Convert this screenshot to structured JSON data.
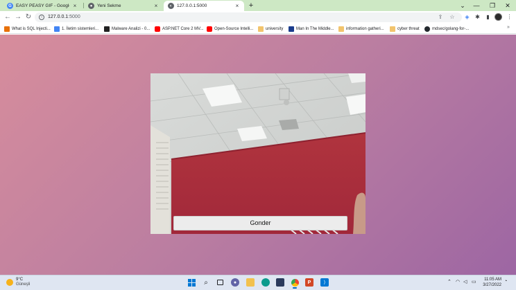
{
  "browser": {
    "tabs": [
      {
        "title": "EASY PEASY GIF - Google Arama",
        "favicon": "google-icon"
      },
      {
        "title": "Yeni Sekme",
        "favicon": "chrome-icon"
      },
      {
        "title": "127.0.0.1:5000",
        "favicon": "globe-icon",
        "active": true
      }
    ],
    "new_tab_label": "+",
    "url": {
      "host": "127.0.0.1",
      "port": ":5000"
    }
  },
  "bookmarks": [
    {
      "label": "What is SQL Injecti...",
      "color": "#e8710a"
    },
    {
      "label": "1. İletim sistemleri...",
      "color": "#4285f4"
    },
    {
      "label": "Malware Analizi - 0...",
      "color": "#222222"
    },
    {
      "label": "ASP.NET Core 2 MV...",
      "color": "#ff0000"
    },
    {
      "label": "Open-Source Intelli...",
      "color": "#ff0000"
    },
    {
      "label": "university",
      "color": "#f2c46d"
    },
    {
      "label": "Man In The Middle...",
      "color": "#1a3c8c"
    },
    {
      "label": "information gatheri...",
      "color": "#f2c46d"
    },
    {
      "label": "cyber threat",
      "color": "#f2c46d"
    },
    {
      "label": "mdsec/golang-for-...",
      "color": "#24292e"
    }
  ],
  "page": {
    "submit_label": "Gonder"
  },
  "taskbar": {
    "weather_temp": "9°C",
    "weather_cond": "Güneşli",
    "time": "11:05 AM",
    "date": "3/27/2022"
  }
}
